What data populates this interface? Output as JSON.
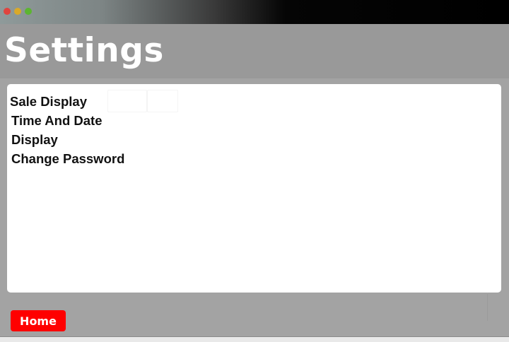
{
  "header": {
    "title": "Settings"
  },
  "menu": {
    "items": [
      {
        "label": "Sale Display"
      },
      {
        "label": "Time And Date"
      },
      {
        "label": "Display"
      },
      {
        "label": "Change Password"
      }
    ]
  },
  "footer": {
    "home_label": "Home"
  },
  "colors": {
    "title_text": "#ffffff",
    "header_bg": "#999999",
    "content_bg": "#a3a3a3",
    "panel_bg": "#ffffff",
    "home_button_bg": "#ff0000"
  }
}
